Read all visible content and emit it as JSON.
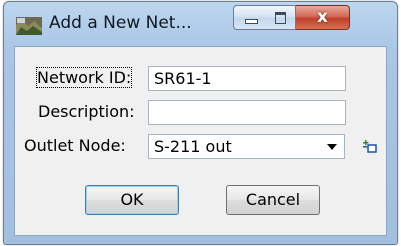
{
  "window": {
    "title": "Add a New Net...",
    "close_glyph": "x"
  },
  "form": {
    "network_id": {
      "label": "Network ID:",
      "value": "SR61-1"
    },
    "description": {
      "label": "Description:",
      "value": ""
    },
    "outlet_node": {
      "label": "Outlet Node:",
      "value": "S-211 out"
    }
  },
  "buttons": {
    "ok": "OK",
    "cancel": "Cancel"
  },
  "icons": {
    "app": "network-app-icon",
    "pick_node": "pick-node-icon",
    "minimize": "minimize-icon",
    "maximize": "maximize-icon",
    "close": "close-icon"
  }
}
